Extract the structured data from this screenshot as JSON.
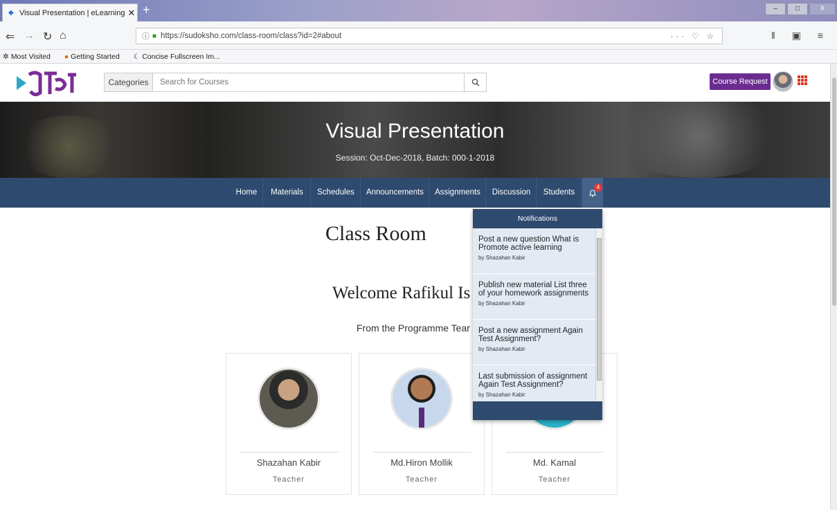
{
  "browser": {
    "tab_title": "Visual Presentation | eLearning",
    "url": "https://sudoksho.com/class-room/class?id=2#about",
    "bookmarks": [
      "Most Visited",
      "Getting Started",
      "Concise Fullscreen Im..."
    ]
  },
  "header": {
    "categories_label": "Categories",
    "search_placeholder": "Search for Courses",
    "course_request_label": "Course Request"
  },
  "hero": {
    "title": "Visual Presentation",
    "subtitle": "Session: Oct-Dec-2018, Batch: 000-1-2018"
  },
  "menu": {
    "items": [
      "Home",
      "Materials",
      "Schedules",
      "Announcements",
      "Assignments",
      "Discussion",
      "Students"
    ],
    "notification_count": "4"
  },
  "main": {
    "title": "Class Room",
    "welcome": "Welcome Rafikul Is",
    "from": "From the Programme Tear"
  },
  "team": [
    {
      "name": "Shazahan Kabir",
      "role": "Teacher"
    },
    {
      "name": "Md.Hiron Mollik",
      "role": "Teacher"
    },
    {
      "name": "Md. Kamal",
      "role": "Teacher"
    }
  ],
  "notifications": {
    "title": "Notifications",
    "items": [
      {
        "text": "Post a new question What is Promote active learning",
        "by": "by Shazahan Kabir"
      },
      {
        "text": "Publish new material List three of your homework assignments",
        "by": "by Shazahan Kabir"
      },
      {
        "text": "Post a new assignment Again Test Assignment?",
        "by": "by Shazahan Kabir"
      },
      {
        "text": "Last submission of assignment Again Test Assignment?",
        "by": "by Shazahan Kabir"
      }
    ]
  },
  "colors": {
    "menu_bg": "#2e4a6e",
    "brand_purple": "#6b2c91",
    "badge_red": "#e13a3a"
  }
}
